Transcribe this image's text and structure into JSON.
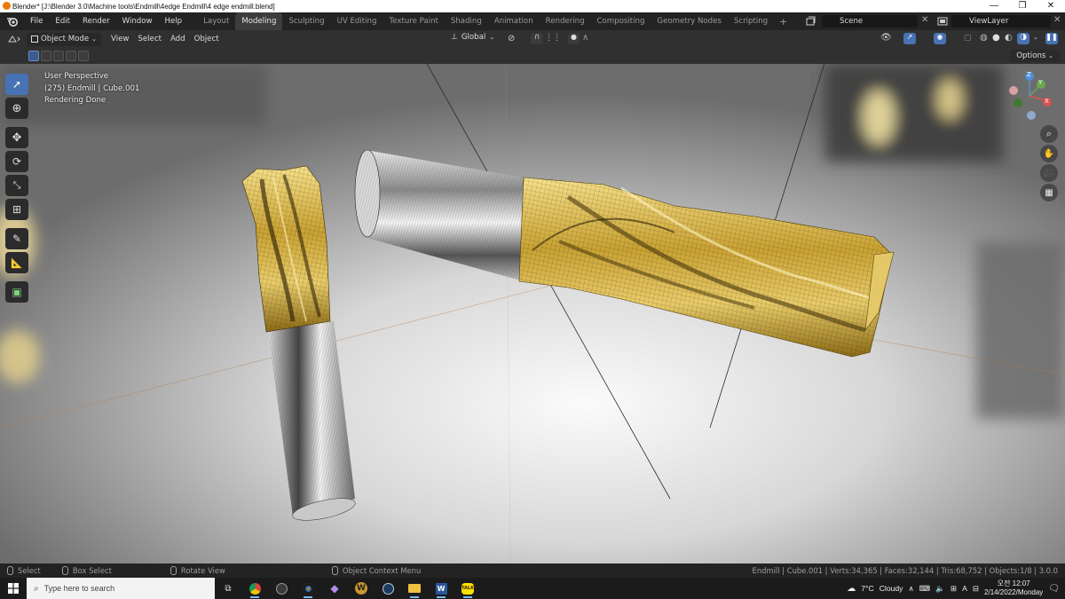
{
  "window": {
    "title": "Blender* [J:\\Blender 3.0\\Machine tools\\Endmill\\4edge Endmill\\4 edge endmill.blend]",
    "controls": [
      "—",
      "❐",
      "✕"
    ]
  },
  "menubar": {
    "menus": [
      "File",
      "Edit",
      "Render",
      "Window",
      "Help"
    ],
    "workspaces": [
      "Layout",
      "Modeling",
      "Sculpting",
      "UV Editing",
      "Texture Paint",
      "Shading",
      "Animation",
      "Rendering",
      "Compositing",
      "Geometry Nodes",
      "Scripting"
    ],
    "active_workspace": "Modeling",
    "scene": "Scene",
    "view_layer": "ViewLayer"
  },
  "header": {
    "mode": "Object Mode",
    "menus": [
      "View",
      "Select",
      "Add",
      "Object"
    ],
    "orientation": "Global"
  },
  "subheader": {
    "options_label": "Options"
  },
  "viewport": {
    "view_name": "User Perspective",
    "object_info": "(275) Endmill | Cube.001",
    "render_status": "Rendering Done",
    "gizmo_axes": {
      "x": "X",
      "y": "Y",
      "z": "Z"
    }
  },
  "statusbar": {
    "select": "Select",
    "box_select": "Box Select",
    "rotate_view": "Rotate View",
    "context_menu": "Object Context Menu",
    "info": "Endmill | Cube.001 | Verts:34,365 | Faces:32,144 | Tris:68,752 | Objects:1/8 | 3.0.0"
  },
  "taskbar": {
    "search_placeholder": "Type here to search",
    "weather_temp": "7°C",
    "weather_desc": "Cloudy",
    "ime_lang": "A",
    "clock_ampm": "오전 12:07",
    "clock_date": "2/14/2022/Monday"
  },
  "colors": {
    "accent": "#4772b3",
    "active_tab": "#3d3d3d",
    "axis_x": "#d9534f",
    "axis_y": "#6aa84f",
    "axis_z": "#4f8fd9"
  }
}
